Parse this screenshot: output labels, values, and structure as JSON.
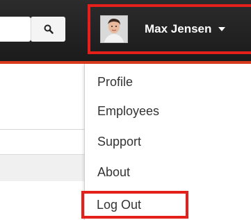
{
  "header": {
    "search": {
      "value": "",
      "placeholder": ""
    },
    "search_button_icon": "magnifier-icon",
    "user_name": "Max Jensen",
    "caret_icon": "caret-down-icon",
    "accent_color": "#d93a1c",
    "highlight_color": "#e5201a"
  },
  "user_menu": {
    "items": [
      {
        "label": "Profile"
      },
      {
        "label": "Employees"
      },
      {
        "label": "Support"
      },
      {
        "label": "About"
      },
      {
        "label": "Log Out"
      }
    ]
  }
}
